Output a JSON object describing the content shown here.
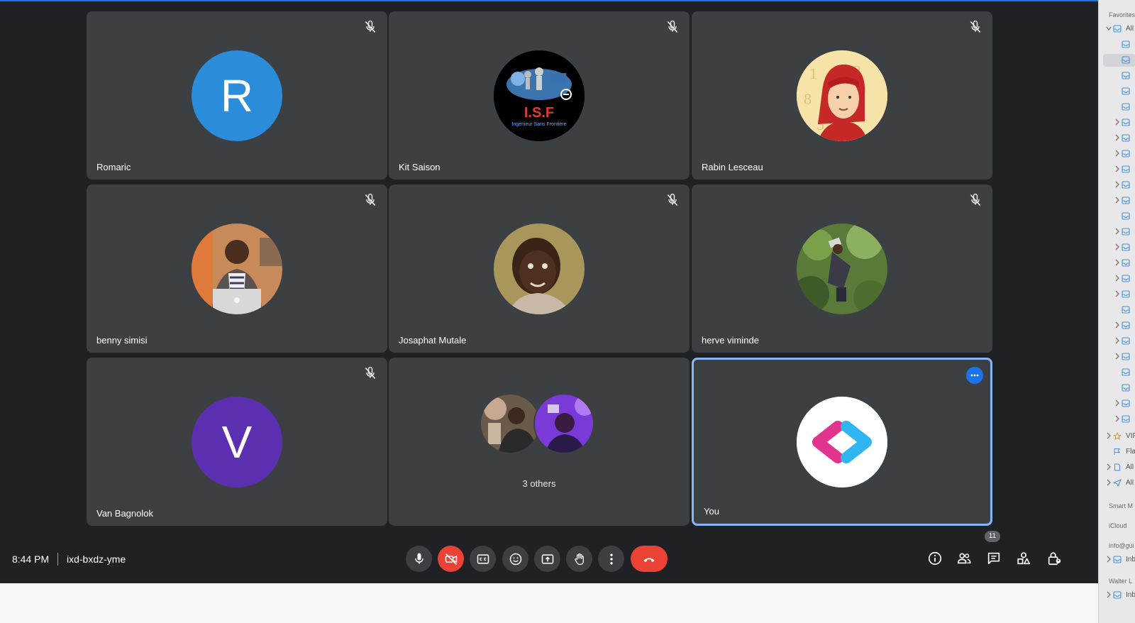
{
  "meeting": {
    "time": "8:44 PM",
    "code": "ixd-bxdz-yme"
  },
  "participants": [
    {
      "name": "Romaric",
      "initial": "R",
      "avatar_color": "#2b8cd9",
      "muted": true
    },
    {
      "name": "Kit Saison",
      "muted": true,
      "logo_text": "I.S.F",
      "logo_subtext": "Ingénieur Sans Frontière"
    },
    {
      "name": "Rabin Lesceau",
      "muted": true
    },
    {
      "name": "benny simisi",
      "muted": true
    },
    {
      "name": "Josaphat Mutale",
      "muted": true
    },
    {
      "name": "herve viminde",
      "muted": true
    },
    {
      "name": "Van Bagnolok",
      "initial": "V",
      "avatar_color": "#5b2fb0",
      "muted": true
    }
  ],
  "others_tile": {
    "label": "3 others"
  },
  "self_tile": {
    "name": "You"
  },
  "people_count": "11",
  "colors": {
    "accent": "#1a73e8",
    "danger": "#ea4335",
    "tile_bg": "#3c4043",
    "page_bg": "#202124",
    "active_border": "#8ab4f8"
  },
  "controls": [
    "microphone-icon",
    "camera-off-icon",
    "captions-icon",
    "emoji-icon",
    "present-icon",
    "raise-hand-icon",
    "more-options-icon",
    "hang-up-icon"
  ],
  "right_controls": [
    "info-icon",
    "people-icon",
    "chat-icon",
    "activities-icon",
    "host-controls-icon"
  ],
  "mail_sidebar": {
    "favorites": "Favorites",
    "all_inboxes": "All",
    "vip": "VIP",
    "flagged": "Fla",
    "all_drafts": "All",
    "all_sent": "All",
    "smart_mailboxes": "Smart M",
    "icloud": "iCloud",
    "account1": "info@gui",
    "inbox1": "Inb",
    "account2": "Walter L",
    "inbox2": "Inb"
  }
}
